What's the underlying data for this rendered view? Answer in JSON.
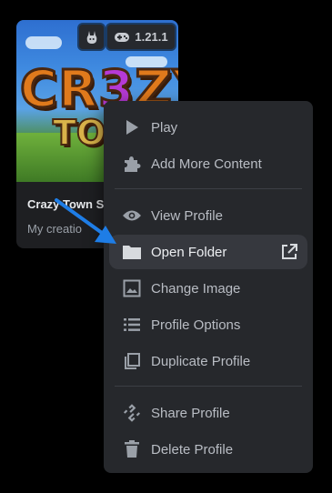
{
  "card": {
    "logo_line1_a": "CR",
    "logo_line1_b": "3",
    "logo_line1_c": "ZY",
    "logo_line2": "TOWN",
    "loader_icon": "rabbit-icon",
    "version_icon": "gamepad-icon",
    "version": "1.21.1",
    "title": "Crazy Town Sa",
    "subtitle": "My creatio"
  },
  "menu": {
    "items": [
      {
        "label": "Play",
        "icon": "play-icon"
      },
      {
        "label": "Add More Content",
        "icon": "puzzle-icon"
      },
      {
        "label": "View Profile",
        "icon": "eye-icon"
      },
      {
        "label": "Open Folder",
        "icon": "folder-icon",
        "trailing_icon": "external-link-icon"
      },
      {
        "label": "Change Image",
        "icon": "image-icon"
      },
      {
        "label": "Profile Options",
        "icon": "list-icon"
      },
      {
        "label": "Duplicate Profile",
        "icon": "copy-icon"
      },
      {
        "label": "Share Profile",
        "icon": "share-icon"
      },
      {
        "label": "Delete Profile",
        "icon": "trash-icon"
      }
    ]
  },
  "colors": {
    "background": "#000000",
    "menu_bg": "#26282c",
    "active_bg": "#36383e",
    "arrow": "#1e7de6"
  }
}
